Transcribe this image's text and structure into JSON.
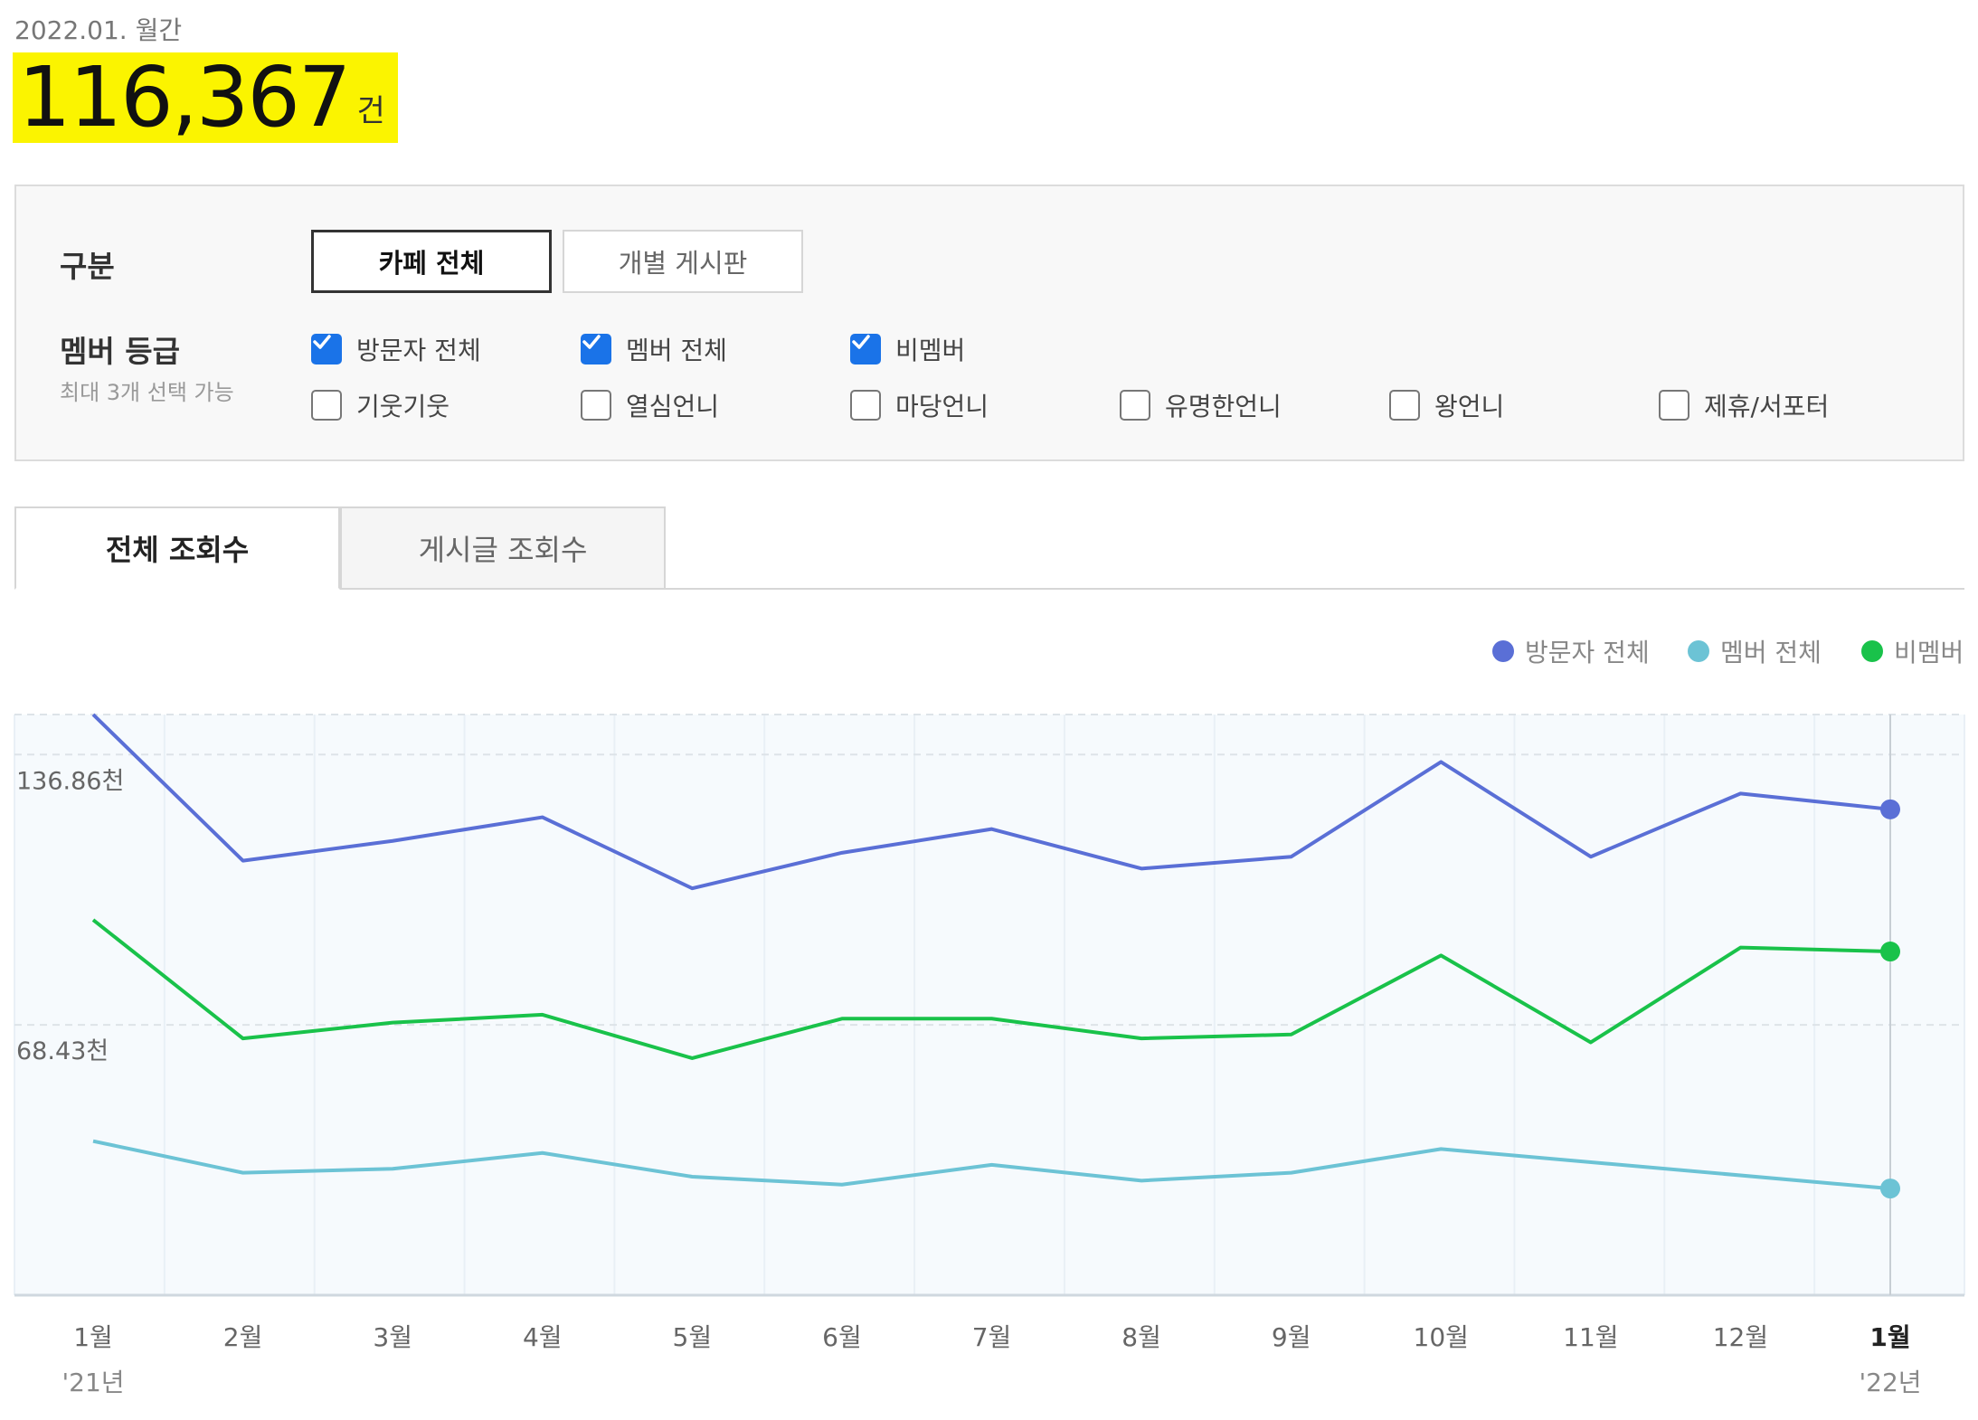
{
  "summary": {
    "period": "2022.01. 월간",
    "total": "116,367",
    "unit": "건"
  },
  "filter": {
    "section_label": "구분",
    "segments": [
      {
        "label": "카페 전체",
        "active": true
      },
      {
        "label": "개별 게시판",
        "active": false
      }
    ],
    "member_label": "멤버 등급",
    "member_sub": "최대 3개 선택 가능",
    "checkboxes": [
      {
        "label": "방문자 전체",
        "checked": true
      },
      {
        "label": "멤버 전체",
        "checked": true
      },
      {
        "label": "비멤버",
        "checked": true
      },
      {
        "label": "기웃기웃",
        "checked": false
      },
      {
        "label": "열심언니",
        "checked": false
      },
      {
        "label": "마당언니",
        "checked": false
      },
      {
        "label": "유명한언니",
        "checked": false
      },
      {
        "label": "왕언니",
        "checked": false
      },
      {
        "label": "제휴/서포터",
        "checked": false
      }
    ]
  },
  "tabs": [
    {
      "label": "전체 조회수",
      "active": true
    },
    {
      "label": "게시글 조회수",
      "active": false
    }
  ],
  "legend": [
    {
      "name": "방문자 전체",
      "color": "#5a6fd6"
    },
    {
      "name": "멤버 전체",
      "color": "#6cc3d5"
    },
    {
      "name": "비멤버",
      "color": "#19c24a"
    }
  ],
  "chart_data": {
    "type": "line",
    "x": [
      "1월",
      "2월",
      "3월",
      "4월",
      "5월",
      "6월",
      "7월",
      "8월",
      "9월",
      "10월",
      "11월",
      "12월",
      "1월"
    ],
    "x_year_labels": [
      {
        "index": 0,
        "label": "'21년"
      },
      {
        "index": 12,
        "label": "'22년"
      }
    ],
    "y_ticks": [
      {
        "value": 136.86,
        "label": "136.86천"
      },
      {
        "value": 68.43,
        "label": "68.43천"
      }
    ],
    "ylim": [
      0,
      147
    ],
    "grid": true,
    "legend_position": "top-right",
    "series": [
      {
        "name": "방문자 전체",
        "color": "#5a6fd6",
        "values": [
          147,
          110,
          115,
          121,
          103,
          112,
          118,
          108,
          111,
          135,
          111,
          127,
          123
        ]
      },
      {
        "name": "멤버 전체",
        "color": "#6cc3d5",
        "values": [
          39,
          31,
          32,
          36,
          30,
          28,
          33,
          29,
          31,
          37,
          null,
          null,
          27
        ]
      },
      {
        "name": "비멤버",
        "color": "#19c24a",
        "values": [
          95,
          65,
          69,
          71,
          60,
          70,
          70,
          65,
          66,
          86,
          64,
          88,
          87
        ]
      }
    ]
  }
}
